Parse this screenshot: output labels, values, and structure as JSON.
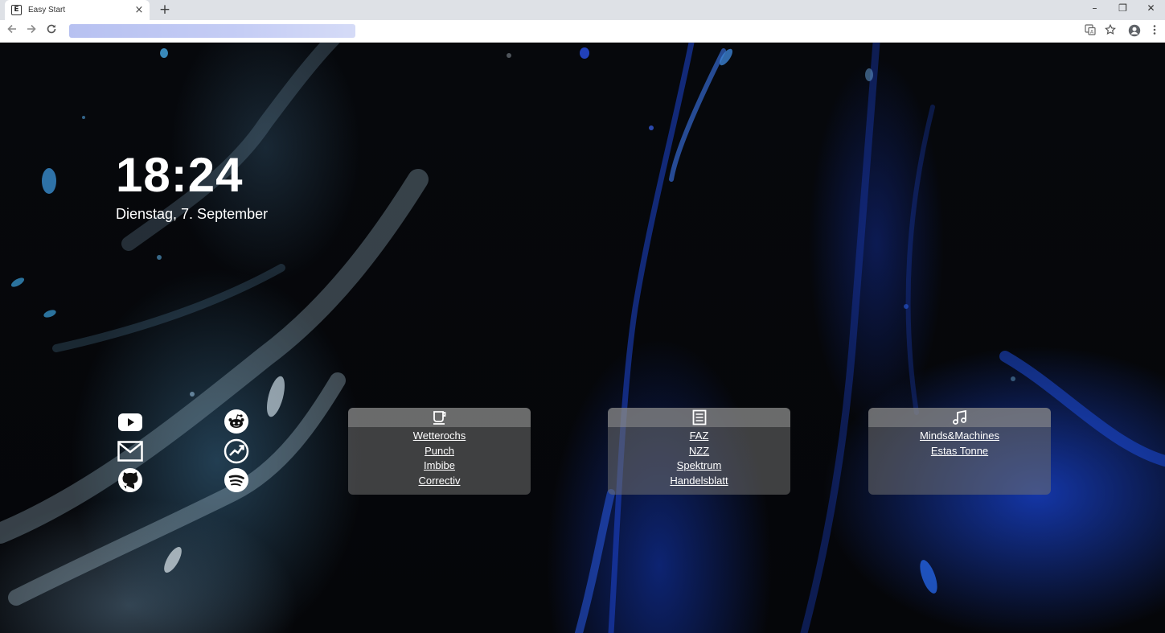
{
  "browser": {
    "tab_title": "Easy Start",
    "tab_favicon_letter": "E",
    "new_tab_label": "+",
    "window": {
      "minimize": "–",
      "restore": "❐",
      "close": "✕"
    }
  },
  "clock": {
    "time": "18:24",
    "date": "Dienstag, 7. September"
  },
  "shortcuts": [
    {
      "name": "youtube",
      "icon": "youtube-icon"
    },
    {
      "name": "reddit",
      "icon": "reddit-icon"
    },
    {
      "name": "mail",
      "icon": "mail-icon"
    },
    {
      "name": "trending",
      "icon": "trending-up-icon"
    },
    {
      "name": "github",
      "icon": "github-icon"
    },
    {
      "name": "spotify",
      "icon": "spotify-icon"
    }
  ],
  "cards": [
    {
      "icon": "coffee-icon",
      "links": [
        "Wetterochs",
        "Punch",
        "Imbibe",
        "Correctiv"
      ]
    },
    {
      "icon": "newspaper-icon",
      "links": [
        "FAZ",
        "NZZ",
        "Spektrum",
        "Handelsblatt"
      ]
    },
    {
      "icon": "music-icon",
      "links": [
        "Minds&Machines",
        "Estas Tonne"
      ]
    }
  ],
  "colors": {
    "accent_blue": "#1f4fe0",
    "card_bg": "#707070",
    "text": "#ffffff"
  }
}
